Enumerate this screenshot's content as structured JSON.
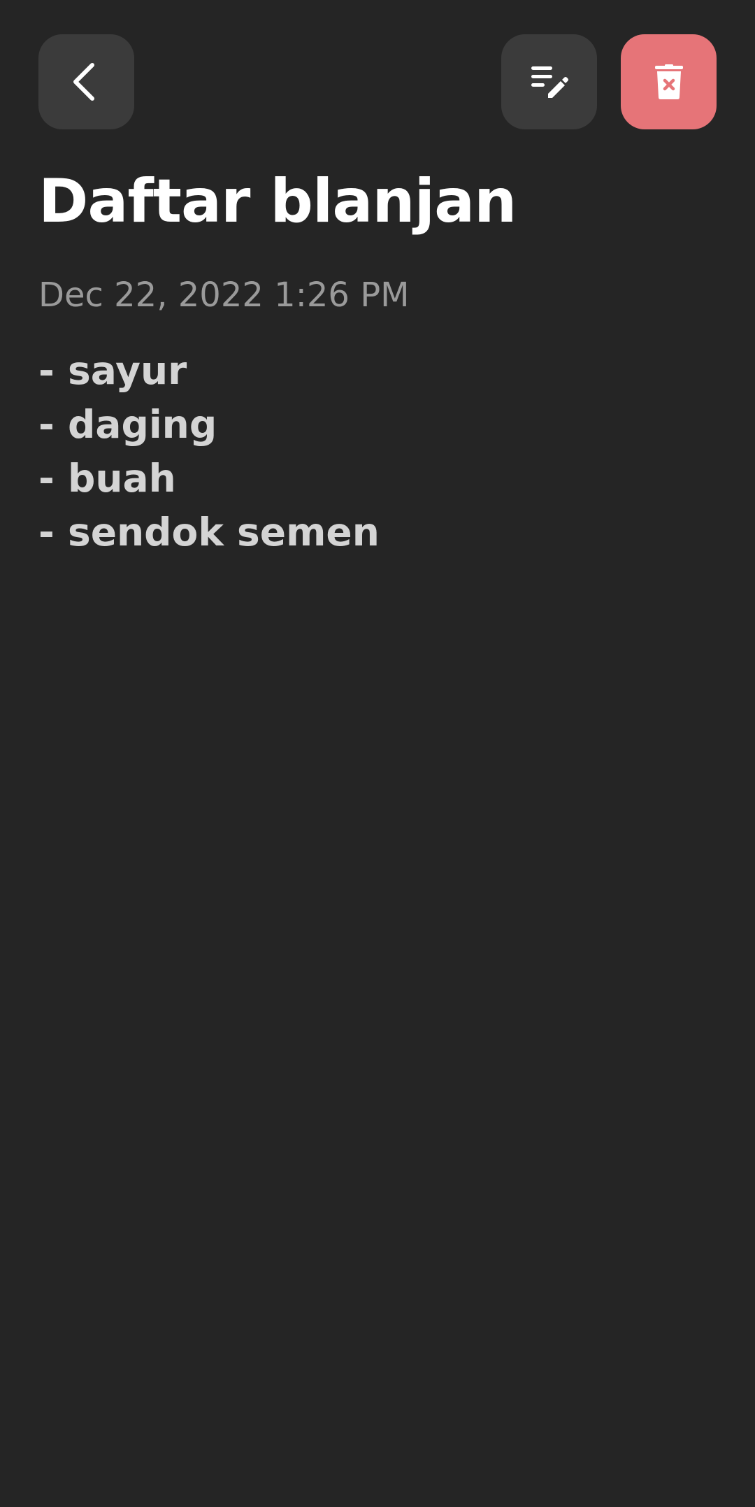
{
  "toolbar": {
    "back_icon": "chevron-left-icon",
    "edit_icon": "edit-note-icon",
    "delete_icon": "delete-icon",
    "delete_color": "#e67478",
    "button_bg": "#3b3b3b"
  },
  "note": {
    "title": "Daftar blanjan",
    "date": "Dec 22, 2022 1:26 PM",
    "lines": [
      "- sayur",
      "- daging",
      "- buah",
      "- sendok semen"
    ]
  },
  "theme": {
    "background": "#252525",
    "title_color": "#ffffff",
    "date_color": "#9a9a9a",
    "body_color": "#d4d4d4"
  }
}
